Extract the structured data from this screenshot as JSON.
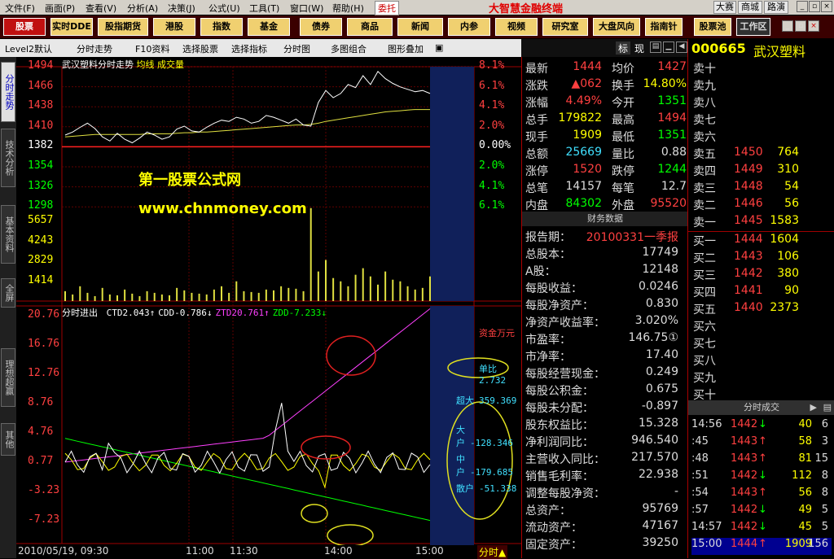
{
  "menubar": {
    "items": [
      "文件(F)",
      "画面(P)",
      "查看(V)",
      "分析(A)",
      "决策(J)",
      "公式(U)",
      "工具(T)",
      "窗口(W)",
      "帮助(H)"
    ],
    "weituo": "委托",
    "brand": "大智慧金融终端",
    "right": [
      "大赛",
      "商城",
      "路演"
    ]
  },
  "nav": [
    "股票",
    "实时DDE",
    "股指期货",
    "港股",
    "指数",
    "基金",
    "债券",
    "商品",
    "新闻",
    "内参",
    "视频",
    "研究室",
    "大盘风向",
    "指南针",
    "股票池",
    "工作区"
  ],
  "toolbar": [
    "Level2默认",
    "分时走势",
    "F10资料",
    "选择股票",
    "选择指标",
    "分时图",
    "多图组合",
    "图形叠加"
  ],
  "panel_tabs": [
    "标",
    "现"
  ],
  "leftnav": [
    "分时走势",
    "技术分析",
    "基本资料",
    "全屏",
    "理想超赢",
    "其他"
  ],
  "chart": {
    "title": "武汉塑料分时走势",
    "legend_avg": "均线",
    "legend_vol": "成交量",
    "price_ticks": [
      "1494",
      "1466",
      "1438",
      "1410",
      "1382",
      "1354",
      "1326",
      "1298"
    ],
    "pct_ticks": [
      "8.1%",
      "6.1%",
      "4.1%",
      "2.0%",
      "0.00%",
      "2.0%",
      "4.1%",
      "6.1%"
    ],
    "vol_ticks": [
      "5657",
      "4243",
      "2829",
      "1414"
    ],
    "ind_ticks": [
      "20.76",
      "16.76",
      "12.76",
      "8.76",
      "4.76",
      "0.77",
      "-3.23",
      "-7.23"
    ],
    "ind_label": "分时进出",
    "ind_values": [
      {
        "k": "CTD",
        "v": "2.043",
        "arrow": "↑",
        "color": "#ffffff"
      },
      {
        "k": "CDD",
        "v": "-0.786",
        "arrow": "↓",
        "color": "#ffffff"
      },
      {
        "k": "ZTD",
        "v": "20.761",
        "arrow": "↑",
        "color": "#ff40ff"
      },
      {
        "k": "ZDD",
        "v": "-7.233",
        "arrow": "↓",
        "color": "#00ff00"
      }
    ],
    "zijin": "资金万元",
    "danbi_label": "单比",
    "danbi": "2.732",
    "flows": [
      {
        "k": "超大",
        "v": "359.369"
      },
      {
        "k": "大户",
        "v": "-128.346"
      },
      {
        "k": "中户",
        "v": "-179.685"
      },
      {
        "k": "散户",
        "v": "-51.338"
      }
    ],
    "time_labels": [
      "2010/05/19, 09:30",
      "11:00",
      "11:30",
      "14:00",
      "15:00"
    ],
    "fenshi": "分时▲",
    "watermark1": "第一股票公式网",
    "watermark2": "www.chnmoney.com",
    "price_range": [
      1270,
      1500
    ],
    "prev_close": 1382
  },
  "chart_data": {
    "type": "line",
    "title": "武汉塑料分时走势",
    "series": [
      {
        "name": "价格",
        "values": [
          1385,
          1390,
          1398,
          1405,
          1396,
          1382,
          1375,
          1388,
          1378,
          1372,
          1380,
          1390,
          1385,
          1378,
          1382,
          1395,
          1400,
          1392,
          1390,
          1398,
          1405,
          1410,
          1408,
          1415,
          1412,
          1405,
          1408,
          1418,
          1415,
          1410,
          1405,
          1412,
          1402,
          1400,
          1440,
          1460,
          1448,
          1455,
          1470,
          1465,
          1485,
          1470,
          1492,
          1480,
          1472,
          1466,
          1462,
          1458,
          1460,
          1455
        ]
      },
      {
        "name": "均线",
        "values": [
          1382,
          1383,
          1384,
          1385,
          1386,
          1386,
          1386,
          1386,
          1386,
          1386,
          1386,
          1387,
          1387,
          1387,
          1387,
          1388,
          1389,
          1389,
          1390,
          1390,
          1391,
          1392,
          1393,
          1394,
          1395,
          1396,
          1397,
          1398,
          1399,
          1400,
          1401,
          1402,
          1402,
          1403,
          1405,
          1408,
          1410,
          1412,
          1414,
          1416,
          1418,
          1420,
          1422,
          1424,
          1425,
          1426,
          1427,
          1428,
          1428,
          1428
        ]
      }
    ],
    "volume": [
      600,
      400,
      900,
      500,
      300,
      800,
      400,
      350,
      700,
      450,
      300,
      600,
      500,
      400,
      350,
      800,
      650,
      500,
      450,
      400,
      700,
      900,
      500,
      1200,
      600,
      550,
      500,
      700,
      650,
      900,
      800,
      750,
      600,
      5657,
      1800,
      2500,
      1400,
      1200,
      900,
      1600,
      2000,
      1500,
      1000,
      1800,
      1300,
      1200,
      900,
      700,
      800,
      1500
    ],
    "ylim": [
      1270,
      1500
    ],
    "xlabel": "",
    "ylabel": ""
  },
  "quote": [
    {
      "k": "最新",
      "v": "1444",
      "vc": "#ff4040",
      "k2": "均价",
      "v2": "1427",
      "v2c": "#ff4040"
    },
    {
      "k": "涨跌",
      "v": "▲062",
      "vc": "#ff4040",
      "k2": "换手",
      "v2": "14.80%",
      "v2c": "#ffff00"
    },
    {
      "k": "涨幅",
      "v": "4.49%",
      "vc": "#ff4040",
      "k2": "今开",
      "v2": "1351",
      "v2c": "#00ff00"
    },
    {
      "k": "总手",
      "v": "179822",
      "vc": "#ffff00",
      "k2": "最高",
      "v2": "1494",
      "v2c": "#ff4040"
    },
    {
      "k": "现手",
      "v": "1909",
      "vc": "#ffff00",
      "k2": "最低",
      "v2": "1351",
      "v2c": "#00ff00"
    },
    {
      "k": "总额",
      "v": "25669",
      "vc": "#40e0ff",
      "k2": "量比",
      "v2": "0.88",
      "v2c": "#dddddd"
    },
    {
      "k": "涨停",
      "v": "1520",
      "vc": "#ff4040",
      "k2": "跌停",
      "v2": "1244",
      "v2c": "#00ff00"
    },
    {
      "k": "总笔",
      "v": "14157",
      "vc": "#dddddd",
      "k2": "每笔",
      "v2": "12.7",
      "v2c": "#dddddd"
    },
    {
      "k": "内盘",
      "v": "84302",
      "vc": "#00ff00",
      "k2": "外盘",
      "v2": "95520",
      "v2c": "#ff4040"
    }
  ],
  "fin_head": "财务数据",
  "finance": [
    {
      "k": "报告期：",
      "v": "20100331一季报",
      "c": "#ff4040"
    },
    {
      "k": "总股本：",
      "v": "17749",
      "c": "#dddddd"
    },
    {
      "k": "A股：",
      "v": "12148",
      "c": "#dddddd"
    },
    {
      "k": "每股收益：",
      "v": "0.0246",
      "c": "#dddddd"
    },
    {
      "k": "每股净资产：",
      "v": "0.830",
      "c": "#dddddd"
    },
    {
      "k": "净资产收益率：",
      "v": "3.020%",
      "c": "#dddddd"
    },
    {
      "k": "市盈率：",
      "v": "146.75①",
      "c": "#dddddd"
    },
    {
      "k": "市净率：",
      "v": "17.40",
      "c": "#dddddd"
    },
    {
      "k": "每股经营现金：",
      "v": "0.249",
      "c": "#dddddd"
    },
    {
      "k": "每股公积金：",
      "v": "0.675",
      "c": "#dddddd"
    },
    {
      "k": "每股未分配：",
      "v": "-0.897",
      "c": "#dddddd"
    },
    {
      "k": "股东权益比：",
      "v": "15.328",
      "c": "#dddddd"
    },
    {
      "k": "净利润同比：",
      "v": "946.540",
      "c": "#dddddd"
    },
    {
      "k": "主营收入同比：",
      "v": "217.570",
      "c": "#dddddd"
    },
    {
      "k": "销售毛利率：",
      "v": "22.938",
      "c": "#dddddd"
    },
    {
      "k": "调整每股净资：",
      "v": "-",
      "c": "#dddddd"
    },
    {
      "k": "总资产：",
      "v": "95769",
      "c": "#dddddd"
    },
    {
      "k": "流动资产：",
      "v": "47167",
      "c": "#dddddd"
    },
    {
      "k": "固定资产：",
      "v": "39250",
      "c": "#dddddd"
    }
  ],
  "stock": {
    "code": "000665",
    "name": "武汉塑料"
  },
  "sell": [
    {
      "k": "卖十",
      "p": "",
      "q": ""
    },
    {
      "k": "卖九",
      "p": "",
      "q": ""
    },
    {
      "k": "卖八",
      "p": "",
      "q": ""
    },
    {
      "k": "卖七",
      "p": "",
      "q": ""
    },
    {
      "k": "卖六",
      "p": "",
      "q": ""
    },
    {
      "k": "卖五",
      "p": "1450",
      "q": "764"
    },
    {
      "k": "卖四",
      "p": "1449",
      "q": "310"
    },
    {
      "k": "卖三",
      "p": "1448",
      "q": "54"
    },
    {
      "k": "卖二",
      "p": "1446",
      "q": "56"
    },
    {
      "k": "卖一",
      "p": "1445",
      "q": "1583"
    }
  ],
  "buy": [
    {
      "k": "买一",
      "p": "1444",
      "q": "1604"
    },
    {
      "k": "买二",
      "p": "1443",
      "q": "106"
    },
    {
      "k": "买三",
      "p": "1442",
      "q": "380"
    },
    {
      "k": "买四",
      "p": "1441",
      "q": "90"
    },
    {
      "k": "买五",
      "p": "1440",
      "q": "2373"
    },
    {
      "k": "买六",
      "p": "",
      "q": ""
    },
    {
      "k": "买七",
      "p": "",
      "q": ""
    },
    {
      "k": "买八",
      "p": "",
      "q": ""
    },
    {
      "k": "买九",
      "p": "",
      "q": ""
    },
    {
      "k": "买十",
      "p": "",
      "q": ""
    }
  ],
  "ticks_head": "分时成交",
  "ticks": [
    {
      "t": "14:56",
      "p": "1442",
      "a": "↓",
      "q": "40",
      "n": "6"
    },
    {
      "t": ":45",
      "p": "1443",
      "a": "↑",
      "q": "58",
      "n": "3"
    },
    {
      "t": ":48",
      "p": "1443",
      "a": "↑",
      "q": "81",
      "n": "15"
    },
    {
      "t": ":51",
      "p": "1442",
      "a": "↓",
      "q": "112",
      "n": "8"
    },
    {
      "t": ":54",
      "p": "1443",
      "a": "↑",
      "q": "56",
      "n": "8"
    },
    {
      "t": ":57",
      "p": "1442",
      "a": "↓",
      "q": "49",
      "n": "5"
    },
    {
      "t": "14:57",
      "p": "1442",
      "a": "↓",
      "q": "45",
      "n": "5"
    },
    {
      "t": "15:00",
      "p": "1444",
      "a": "↑",
      "q": "1909",
      "n": "156"
    }
  ]
}
